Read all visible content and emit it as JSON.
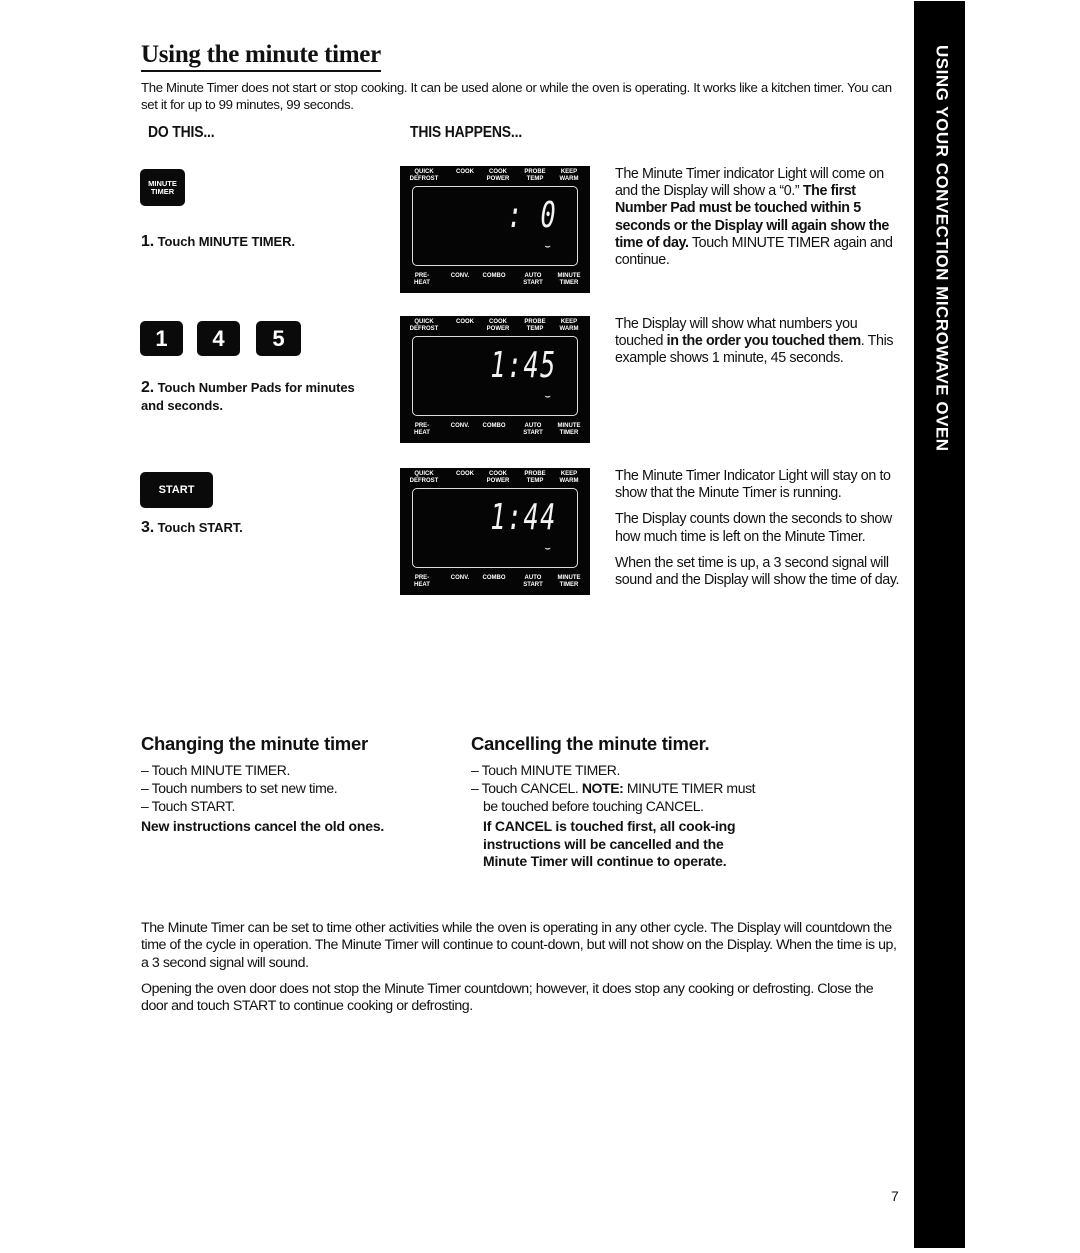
{
  "page": {
    "title": "Using the minute timer",
    "intro": "The Minute Timer does not start or stop cooking. It can be used alone or while the oven is operating. It works like a kitchen timer. You can set it for up to 99 minutes, 99 seconds.",
    "col_do": "DO THIS...",
    "col_happens": "THIS HAPPENS...",
    "page_number": "7",
    "sidebar_tab": "USING YOUR CONVECTION MICROWAVE OVEN"
  },
  "display_labels": {
    "top": [
      "QUICK\nDEFROST",
      "COOK",
      "COOK\nPOWER",
      "PROBE\nTEMP",
      "KEEP\nWARM"
    ],
    "bottom": [
      "PRE-\nHEAT",
      "CONV.",
      "COMBO",
      "AUTO\nSTART",
      "MINUTE\nTIMER"
    ]
  },
  "steps": [
    {
      "keys": [
        "MINUTE\nTIMER"
      ],
      "number": "1.",
      "label": "Touch MINUTE TIMER.",
      "display": ":  0",
      "desc_parts": [
        {
          "text": "The Minute Timer indicator Light will come on and the Display will show a “0.” ",
          "bold": false
        },
        {
          "text": "The first Number Pad must be touched within 5 seconds or the Display will again show the time of day.",
          "bold": true
        },
        {
          "text": " Touch MINUTE TIMER again and continue.",
          "bold": false
        }
      ]
    },
    {
      "keys": [
        "1",
        "4",
        "5"
      ],
      "number": "2.",
      "label": "Touch Number Pads for minutes and seconds.",
      "display": "1:45",
      "desc_parts": [
        {
          "text": "The Display will show what numbers you touched ",
          "bold": false
        },
        {
          "text": "in the order you touched them",
          "bold": true
        },
        {
          "text": ". This example shows 1 minute, 45 seconds.",
          "bold": false
        }
      ]
    },
    {
      "keys": [
        "START"
      ],
      "number": "3.",
      "label": "Touch START.",
      "display": "1:44",
      "desc_paragraphs": [
        "The Minute Timer Indicator Light will stay on to show that the Minute Timer is running.",
        "The Display counts down the seconds to show how much time is left on the Minute Timer.",
        "When the set time is up, a 3 second signal will sound and the Display will show the time of day."
      ]
    }
  ],
  "changing": {
    "heading": "Changing the minute timer",
    "items": [
      "– Touch MINUTE TIMER.",
      "– Touch numbers to set new time.",
      "– Touch START."
    ],
    "note": "New instructions cancel the old ones."
  },
  "cancelling": {
    "heading": "Cancelling the minute timer.",
    "item1": "– Touch MINUTE TIMER.",
    "item2_pre": "– Touch CANCEL. ",
    "item2_bold": "NOTE:",
    "item2_post": " MINUTE TIMER must be touched before touching CANCEL.",
    "note": "If CANCEL is touched first, all cook-ing instructions will be cancelled and the Minute Timer will continue to operate."
  },
  "footer_paragraphs": [
    "The Minute Timer can be set to time other activities while the oven is operating in any other cycle. The Display will countdown the time of the cycle in operation. The Minute Timer will continue to count-down, but will not show on the Display. When the time is up, a 3 second signal will sound.",
    "Opening the oven door does not stop the Minute Timer countdown; however, it does stop any cooking or defrosting. Close the door and touch START to continue cooking or defrosting."
  ]
}
